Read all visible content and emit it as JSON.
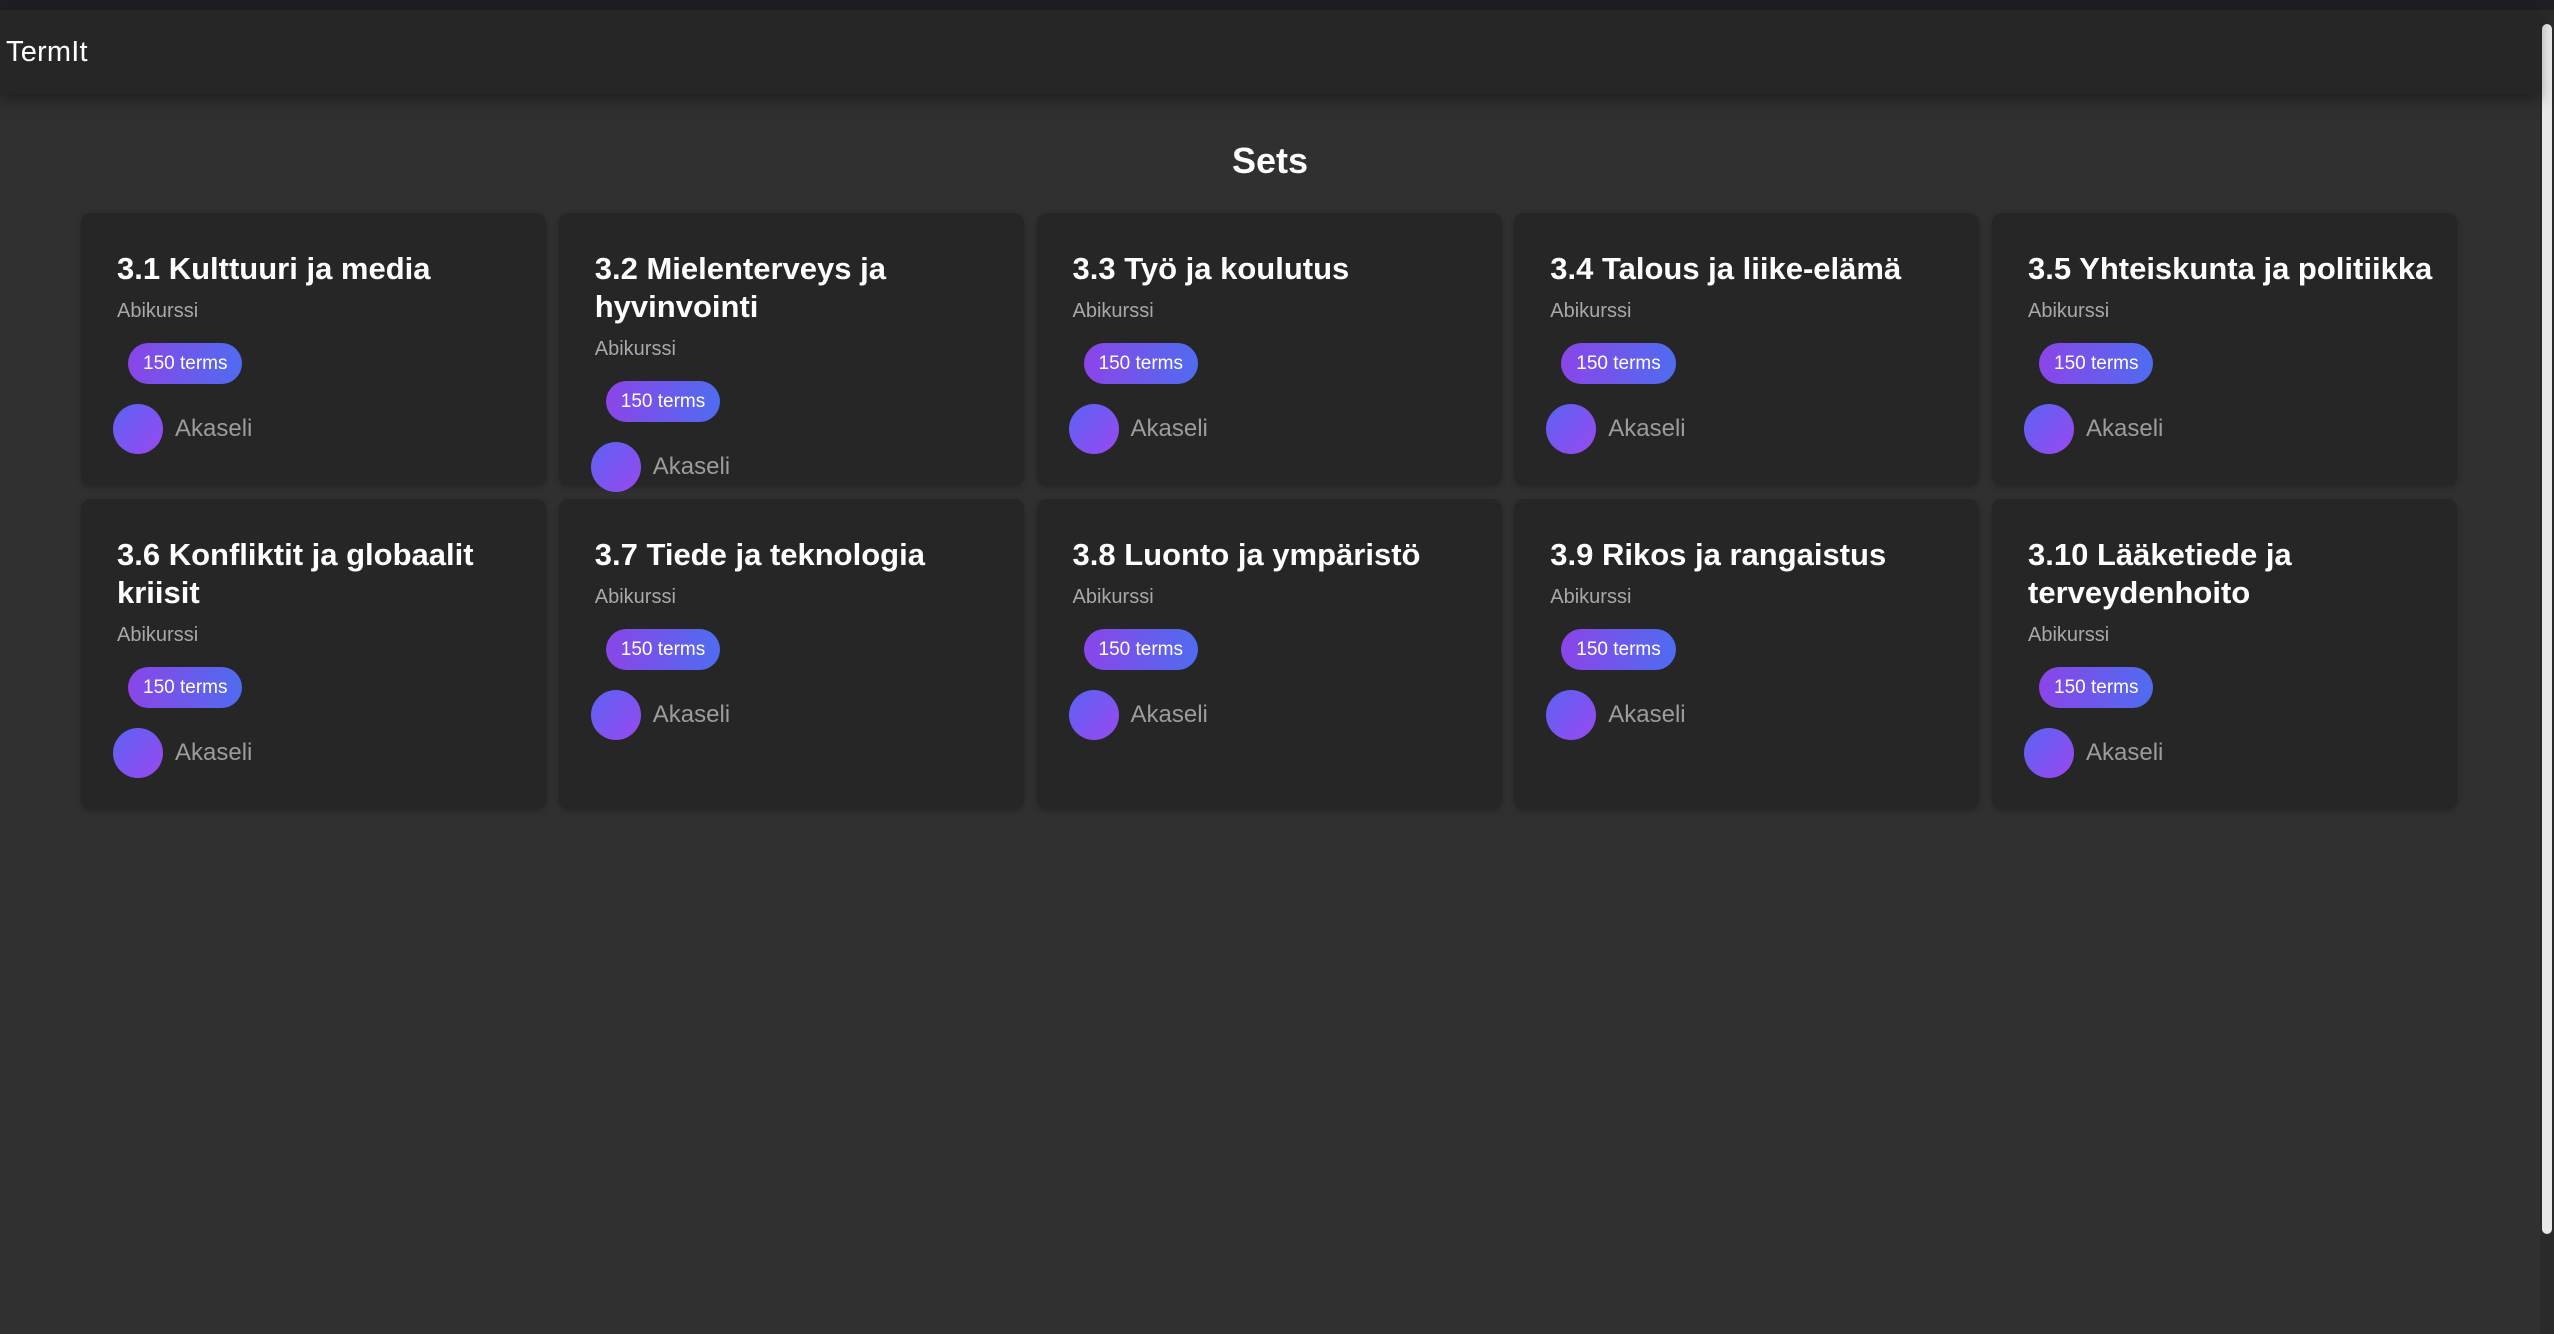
{
  "app": {
    "brand": "TermIt"
  },
  "page": {
    "title": "Sets"
  },
  "sets": [
    {
      "title": "3.1 Kulttuuri ja media",
      "subtitle": "Abikurssi",
      "terms": "150 terms",
      "author": "Akaseli"
    },
    {
      "title": "3.2 Mielenterveys ja hyvinvointi",
      "subtitle": "Abikurssi",
      "terms": "150 terms",
      "author": "Akaseli"
    },
    {
      "title": "3.3 Työ ja koulutus",
      "subtitle": "Abikurssi",
      "terms": "150 terms",
      "author": "Akaseli"
    },
    {
      "title": "3.4 Talous ja liike-elämä",
      "subtitle": "Abikurssi",
      "terms": "150 terms",
      "author": "Akaseli"
    },
    {
      "title": "3.5 Yhteiskunta ja politiikka",
      "subtitle": "Abikurssi",
      "terms": "150 terms",
      "author": "Akaseli"
    },
    {
      "title": "3.6 Konfliktit ja globaalit kriisit",
      "subtitle": "Abikurssi",
      "terms": "150 terms",
      "author": "Akaseli"
    },
    {
      "title": "3.7 Tiede ja teknologia",
      "subtitle": "Abikurssi",
      "terms": "150 terms",
      "author": "Akaseli"
    },
    {
      "title": "3.8 Luonto ja ympäristö",
      "subtitle": "Abikurssi",
      "terms": "150 terms",
      "author": "Akaseli"
    },
    {
      "title": "3.9 Rikos ja rangaistus",
      "subtitle": "Abikurssi",
      "terms": "150 terms",
      "author": "Akaseli"
    },
    {
      "title": "3.10 Lääketiede ja terveydenhoito",
      "subtitle": "Abikurssi",
      "terms": "150 terms",
      "author": "Akaseli"
    }
  ],
  "colors": {
    "background": "#303030",
    "card": "#262626",
    "navbar": "#262626",
    "badge_gradient_start": "#8b45e8",
    "badge_gradient_end": "#4f6cf0"
  }
}
